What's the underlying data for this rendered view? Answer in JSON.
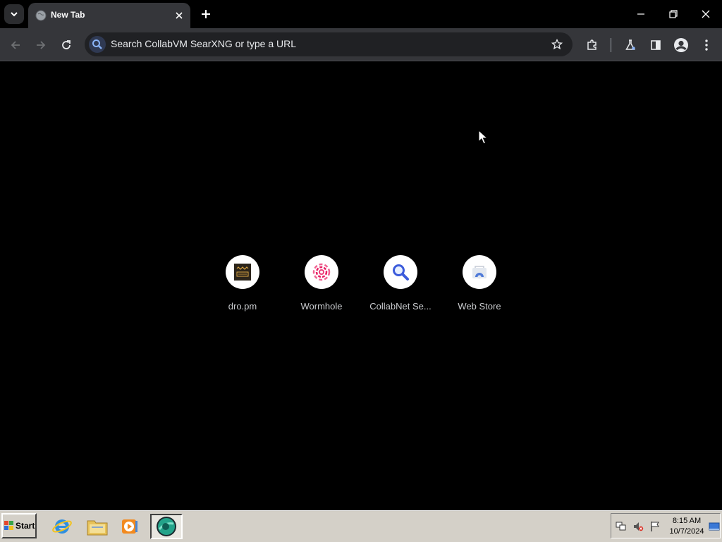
{
  "tab": {
    "title": "New Tab"
  },
  "omnibox": {
    "placeholder": "Search CollabVM SearXNG or type a URL"
  },
  "shortcuts": [
    {
      "label": "dro.pm",
      "icon": "dro-pm-icon"
    },
    {
      "label": "Wormhole",
      "icon": "wormhole-icon"
    },
    {
      "label": "CollabNet Se...",
      "icon": "search-icon"
    },
    {
      "label": "Web Store",
      "icon": "web-store-icon"
    }
  ],
  "taskbar": {
    "start_label": "Start",
    "clock_time": "8:15 AM",
    "clock_date": "10/7/2024"
  },
  "colors": {
    "page_bg": "#000000",
    "toolbar_bg": "#35363a",
    "omnibox_bg": "#202124",
    "taskbar_bg": "#d4d0c8",
    "accent_blue": "#8ab4f8"
  }
}
